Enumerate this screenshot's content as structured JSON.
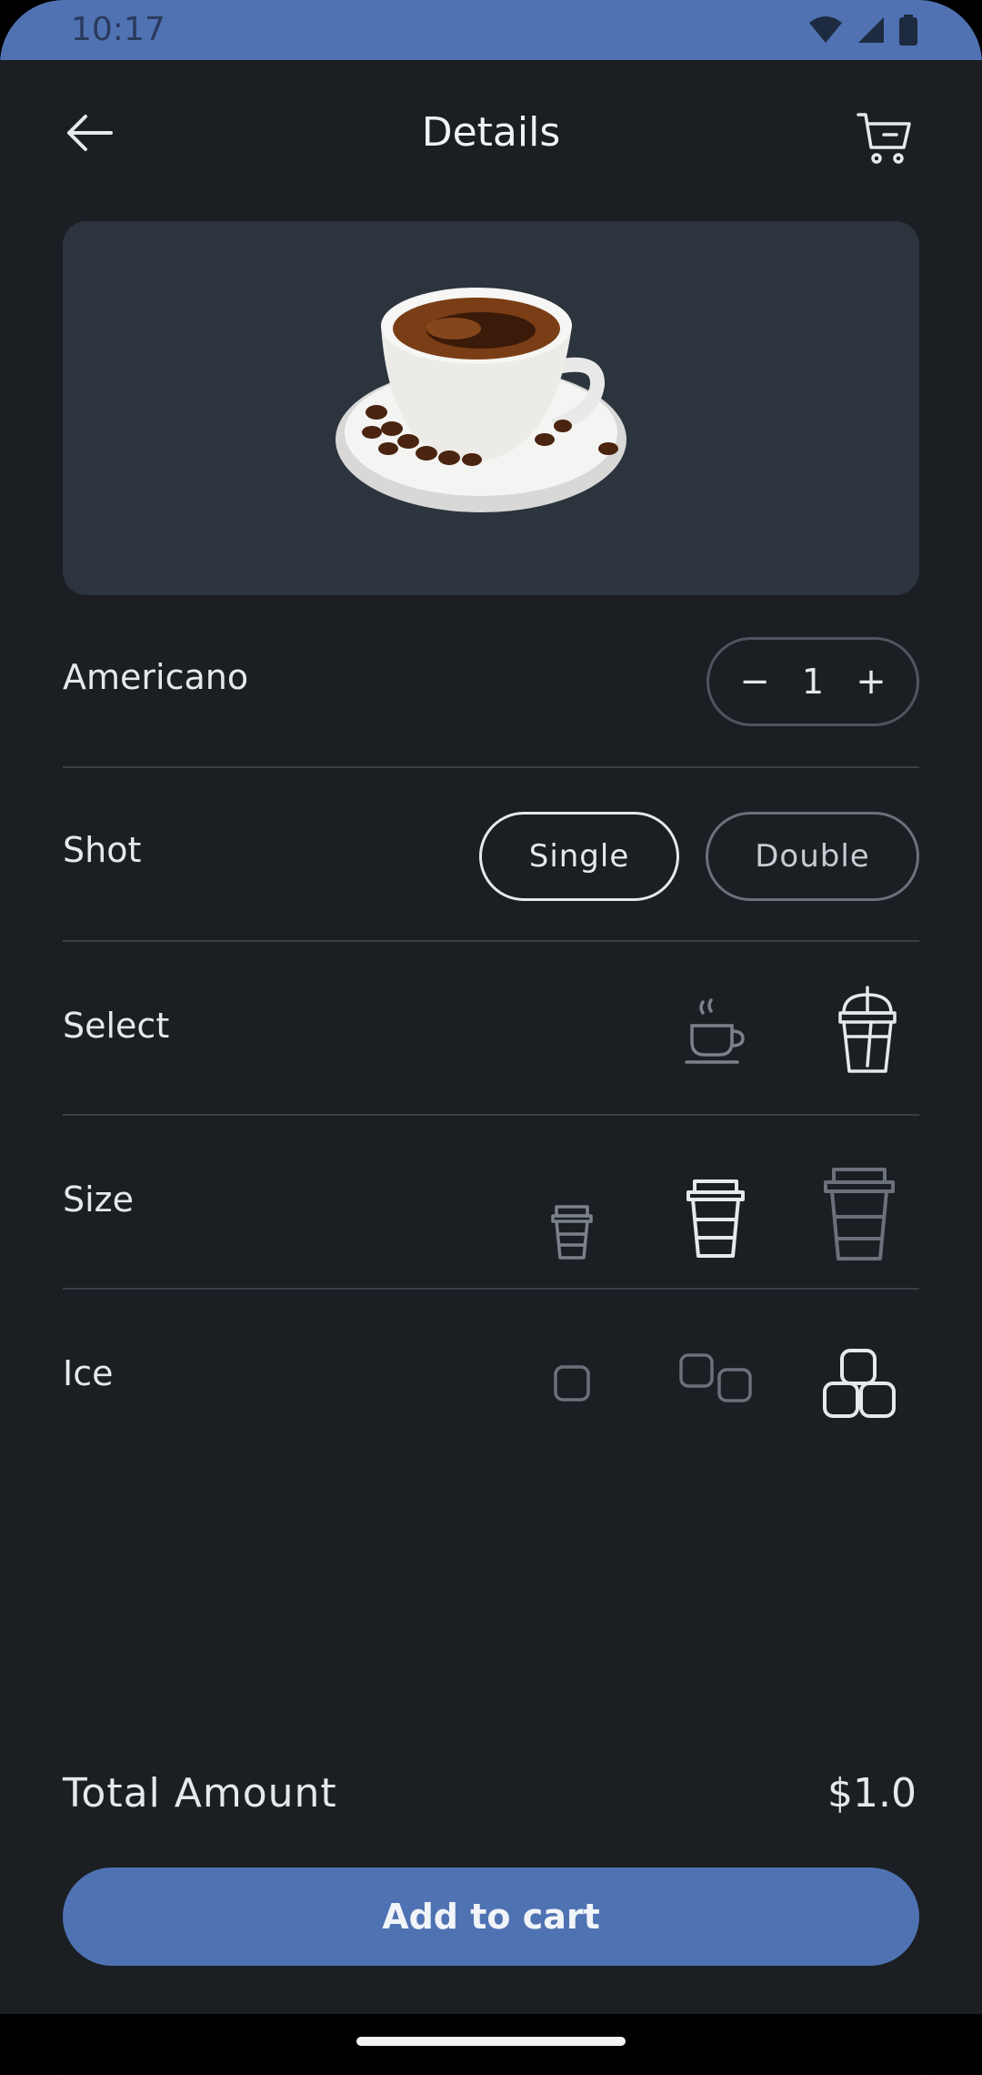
{
  "status_bar": {
    "time": "10:17",
    "icons": [
      "wifi-icon",
      "signal-icon",
      "battery-icon"
    ],
    "background": "#5072b3"
  },
  "app_bar": {
    "title": "Details",
    "back_icon": "arrow-left-icon",
    "cart_icon": "cart-icon"
  },
  "product": {
    "name": "Americano",
    "image": "coffee-cup-with-beans",
    "quantity": "1",
    "decrement_symbol": "−",
    "increment_symbol": "+"
  },
  "shot": {
    "label": "Shot",
    "options": [
      "Single",
      "Double"
    ],
    "selected": "Single"
  },
  "select": {
    "label": "Select",
    "options": [
      "hot-cup-icon",
      "iced-cup-icon"
    ],
    "selected": "iced-cup-icon"
  },
  "size": {
    "label": "Size",
    "options": [
      "small-cup-icon",
      "medium-cup-icon",
      "large-cup-icon"
    ],
    "selected": "medium-cup-icon"
  },
  "ice": {
    "label": "Ice",
    "options": [
      "ice-one-icon",
      "ice-two-icon",
      "ice-three-icon"
    ],
    "selected": "ice-three-icon"
  },
  "total": {
    "label": "Total Amount",
    "value": "$1.0"
  },
  "cta": {
    "label": "Add to cart"
  },
  "colors": {
    "background": "#1b1e22",
    "card": "#2c343e",
    "accent": "#4f72b3",
    "text": "#e6e8eb",
    "muted": "#6a717b"
  }
}
